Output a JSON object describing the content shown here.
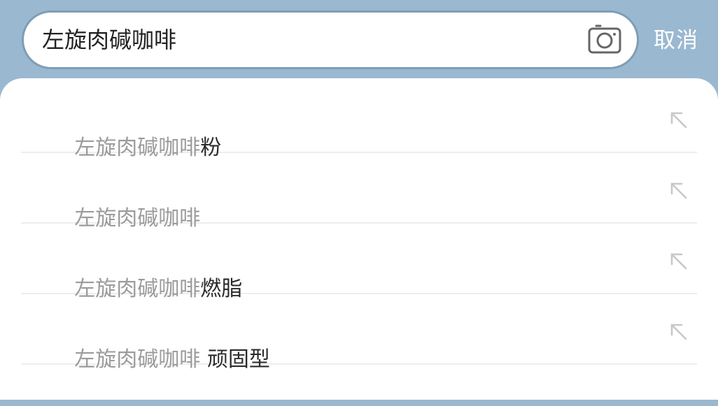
{
  "search": {
    "value": "左旋肉碱咖啡",
    "camera_icon": "camera-icon",
    "cancel_label": "取消"
  },
  "suggestions": [
    {
      "prefix": "左旋肉碱咖啡",
      "suffix": "粉"
    },
    {
      "prefix": "左旋肉碱咖啡",
      "suffix": ""
    },
    {
      "prefix": "左旋肉碱咖啡",
      "suffix": "燃脂"
    },
    {
      "prefix": "左旋肉碱咖啡",
      "suffix": " 顽固型"
    }
  ],
  "icons": {
    "fill": "arrow-up-left-icon"
  },
  "colors": {
    "header_bg": "#9ab8d0",
    "search_border": "#7f9db5",
    "muted_text": "#9b9b9b",
    "strong_text": "#2a2a2a"
  }
}
